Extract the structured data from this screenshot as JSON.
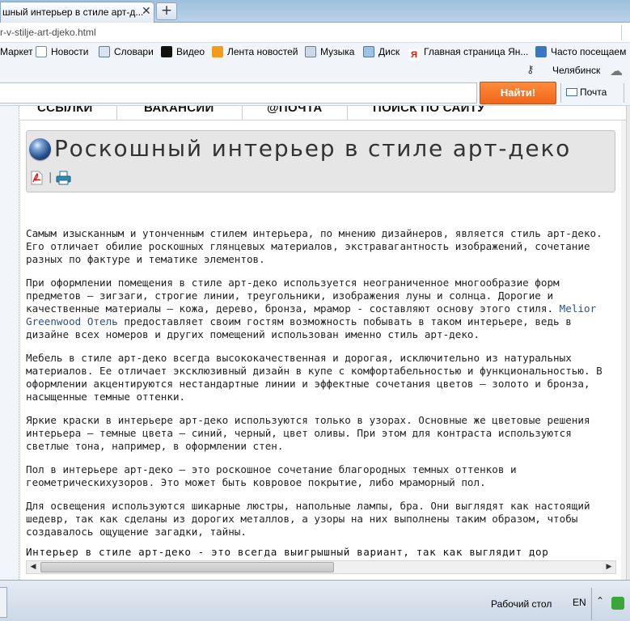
{
  "browser": {
    "tab_title": "шный интерьер в стиле арт-д...",
    "tab_close": "✕",
    "new_tab": "+",
    "url": "r-v-stilje-art-djeko.html"
  },
  "bookmarks": [
    {
      "label": "Маркет"
    },
    {
      "label": "Новости"
    },
    {
      "label": "Словари"
    },
    {
      "label": "Видео"
    },
    {
      "label": "Лента новостей"
    },
    {
      "label": "Музыка"
    },
    {
      "label": "Диск"
    },
    {
      "label": "Главная страница Ян..."
    },
    {
      "label": "Часто посещаем"
    }
  ],
  "yandex_bar": {
    "city": "Челябинск",
    "search_button": "Найти!",
    "mail": "Почта"
  },
  "site_nav": [
    {
      "label": "ССЫЛКИ"
    },
    {
      "label": "ВАКАНСИИ"
    },
    {
      "label": "@ПОЧТА"
    },
    {
      "label": "ПОИСК ПО САЙТУ"
    }
  ],
  "article": {
    "title": "Роскошный интерьер в стиле арт-деко",
    "separator": "|",
    "paragraphs": [
      "Самым изысканным и утонченным стилем интерьера, по мнению дизайнеров, является стиль арт-деко. Его отличает обилие роскошных глянцевых материалов, экстравагантность изображений, сочетание разных по фактуре и тематике элементов.",
      "Мебель в стиле арт-деко всегда высококачественная и дорогая, исключительно из натуральных материалов. Ее отличает эксклюзивный дизайн в купе с комфортабельностью и функциональностью. В оформлении акцентируются нестандартные линии и эффектные сочетания цветов – золото и бронза, насыщенные темные оттенки.",
      "Яркие краски в интерьере арт-деко используются только в узорах. Основные же цветовые решения интерьера – темные цвета – синий, черный, цвет оливы. При этом для контраста используются светлые тона, например, в оформлении стен.",
      "Пол в интерьере арт-деко – это роскошное сочетание благородных темных оттенков и геометрическихузоров. Это может быть ковровое покрытие, либо мраморный пол.",
      "Для освещения используются шикарные люстры, напольные лампы, бра. Они выглядят как настоящий шедевр, так как сделаны из дорогих металлов, а узоры на них выполнены таким образом, чтобы создавалось ощущение загадки, тайны."
    ],
    "p2_before": "При оформлении помещения в стиле арт-деко используется неограниченное многообразие форм предметов – зигзаги, строгие линии, треугольники, изображения луны и солнца. Дорогие и качественные материалы – кожа, дерево, бронза, мрамор - составляют основу этого стиля. ",
    "p2_link": "Melior Greenwood Отель",
    "p2_after": " предоставляет своим гостям возможность побывать в таком интерьере, ведь в дизайне всех номеров и других помещений использован именно стиль арт-деко.",
    "last_line": "Интерьер в стиле арт-деко - это всегда выигрышный вариант, так как выглядит  дор"
  },
  "taskbar": {
    "desktop": "Рабочий стол",
    "lang": "EN"
  },
  "colors": {
    "search_button": "#f0661a",
    "link": "#2c4f8a",
    "title_bg": "#e6e6e6"
  }
}
